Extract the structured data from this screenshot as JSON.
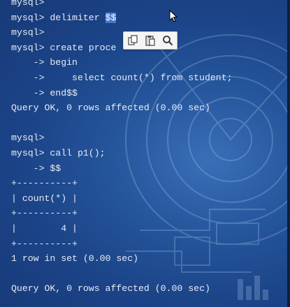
{
  "terminal": {
    "lines": [
      {
        "segments": [
          {
            "text": "mysql>"
          }
        ]
      },
      {
        "segments": [
          {
            "text": "mysql> delimiter "
          },
          {
            "text": "$$",
            "selected": true
          }
        ]
      },
      {
        "segments": [
          {
            "text": "mysql>"
          }
        ]
      },
      {
        "segments": [
          {
            "text": "mysql> create proce"
          }
        ]
      },
      {
        "segments": [
          {
            "text": "    -> begin"
          }
        ]
      },
      {
        "segments": [
          {
            "text": "    ->     select count(*) from student;"
          }
        ]
      },
      {
        "segments": [
          {
            "text": "    -> end$$"
          }
        ]
      },
      {
        "segments": [
          {
            "text": "Query OK, 0 rows affected (0.00 sec)"
          }
        ]
      },
      {
        "segments": [
          {
            "text": ""
          }
        ]
      },
      {
        "segments": [
          {
            "text": "mysql>"
          }
        ]
      },
      {
        "segments": [
          {
            "text": "mysql> call p1();"
          }
        ]
      },
      {
        "segments": [
          {
            "text": "    -> $$"
          }
        ]
      },
      {
        "segments": [
          {
            "text": "+----------+"
          }
        ]
      },
      {
        "segments": [
          {
            "text": "| count(*) |"
          }
        ]
      },
      {
        "segments": [
          {
            "text": "+----------+"
          }
        ]
      },
      {
        "segments": [
          {
            "text": "|        4 |"
          }
        ]
      },
      {
        "segments": [
          {
            "text": "+----------+"
          }
        ]
      },
      {
        "segments": [
          {
            "text": "1 row in set (0.00 sec)"
          }
        ]
      },
      {
        "segments": [
          {
            "text": ""
          }
        ]
      },
      {
        "segments": [
          {
            "text": "Query OK, 0 rows affected (0.00 sec)"
          }
        ]
      }
    ]
  },
  "toolbar": {
    "buttons": [
      {
        "name": "copy-button",
        "icon": "copy-icon"
      },
      {
        "name": "paste-button",
        "icon": "paste-icon"
      },
      {
        "name": "search-button",
        "icon": "search-icon"
      }
    ]
  },
  "colors": {
    "background": "#1b4387",
    "text": "#e8ecf4",
    "selection": "#4a78c8"
  }
}
